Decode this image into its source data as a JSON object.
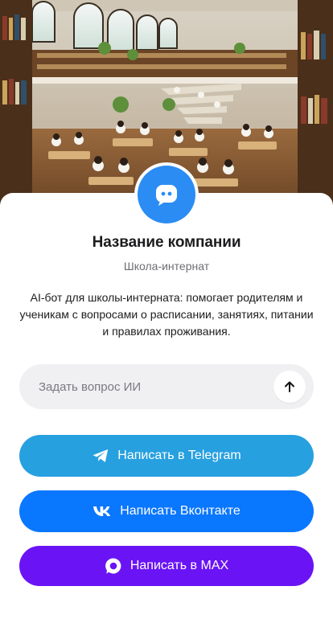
{
  "company": {
    "name": "Название компании",
    "type": "Школа-интернат",
    "description": "AI-бот для школы-интерната: помогает родителям и ученикам с вопросами о расписании, занятиях, питании и правилах проживания."
  },
  "hero": {
    "image_icon": "library-illustration"
  },
  "avatar": {
    "icon": "chat-bot-icon",
    "color": "#2b8cf3"
  },
  "ask": {
    "placeholder": "Задать вопрос ИИ",
    "value": "",
    "send_icon": "arrow-up-icon"
  },
  "actions": {
    "telegram": {
      "label": "Написать в Telegram",
      "icon": "telegram-icon",
      "color": "#27a0e0"
    },
    "vk": {
      "label": "Написать Вконтакте",
      "icon": "vk-icon",
      "color": "#0a77ff"
    },
    "max": {
      "label": "Написать в MAX",
      "icon": "max-icon",
      "color": "#6a14f5"
    }
  }
}
